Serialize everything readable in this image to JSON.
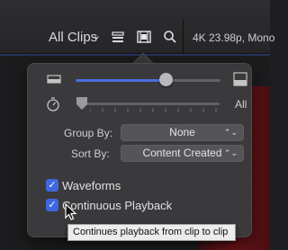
{
  "toolbar": {
    "clips_label": "All Clips",
    "clips_chevron": "⌄",
    "icons": [
      "clip-appearance-icon",
      "filmstrip-icon",
      "search-icon"
    ],
    "viewer_info": "4K 23.98p, Mono"
  },
  "popover": {
    "clip_height_slider": {
      "value": 0.75,
      "small_icon": "small-clip-icon",
      "large_icon": "large-clip-icon"
    },
    "duration_slider": {
      "value": 0.0,
      "icon": "stopwatch-icon",
      "end_label": "All"
    },
    "group_by": {
      "label": "Group By:",
      "value": "None"
    },
    "sort_by": {
      "label": "Sort By:",
      "value": "Content Created"
    },
    "popup_chevron": "⌃⌄",
    "waveforms": {
      "label": "Waveforms",
      "checked": true
    },
    "continuous_playback": {
      "label": "Continuous Playback",
      "checked": true
    }
  },
  "tooltip": {
    "text": "Continues playback from clip to clip"
  },
  "colors": {
    "accent": "#3f67df",
    "popover_bg": "#3a3a3c",
    "toolbar_bg": "#2a2a2c"
  }
}
